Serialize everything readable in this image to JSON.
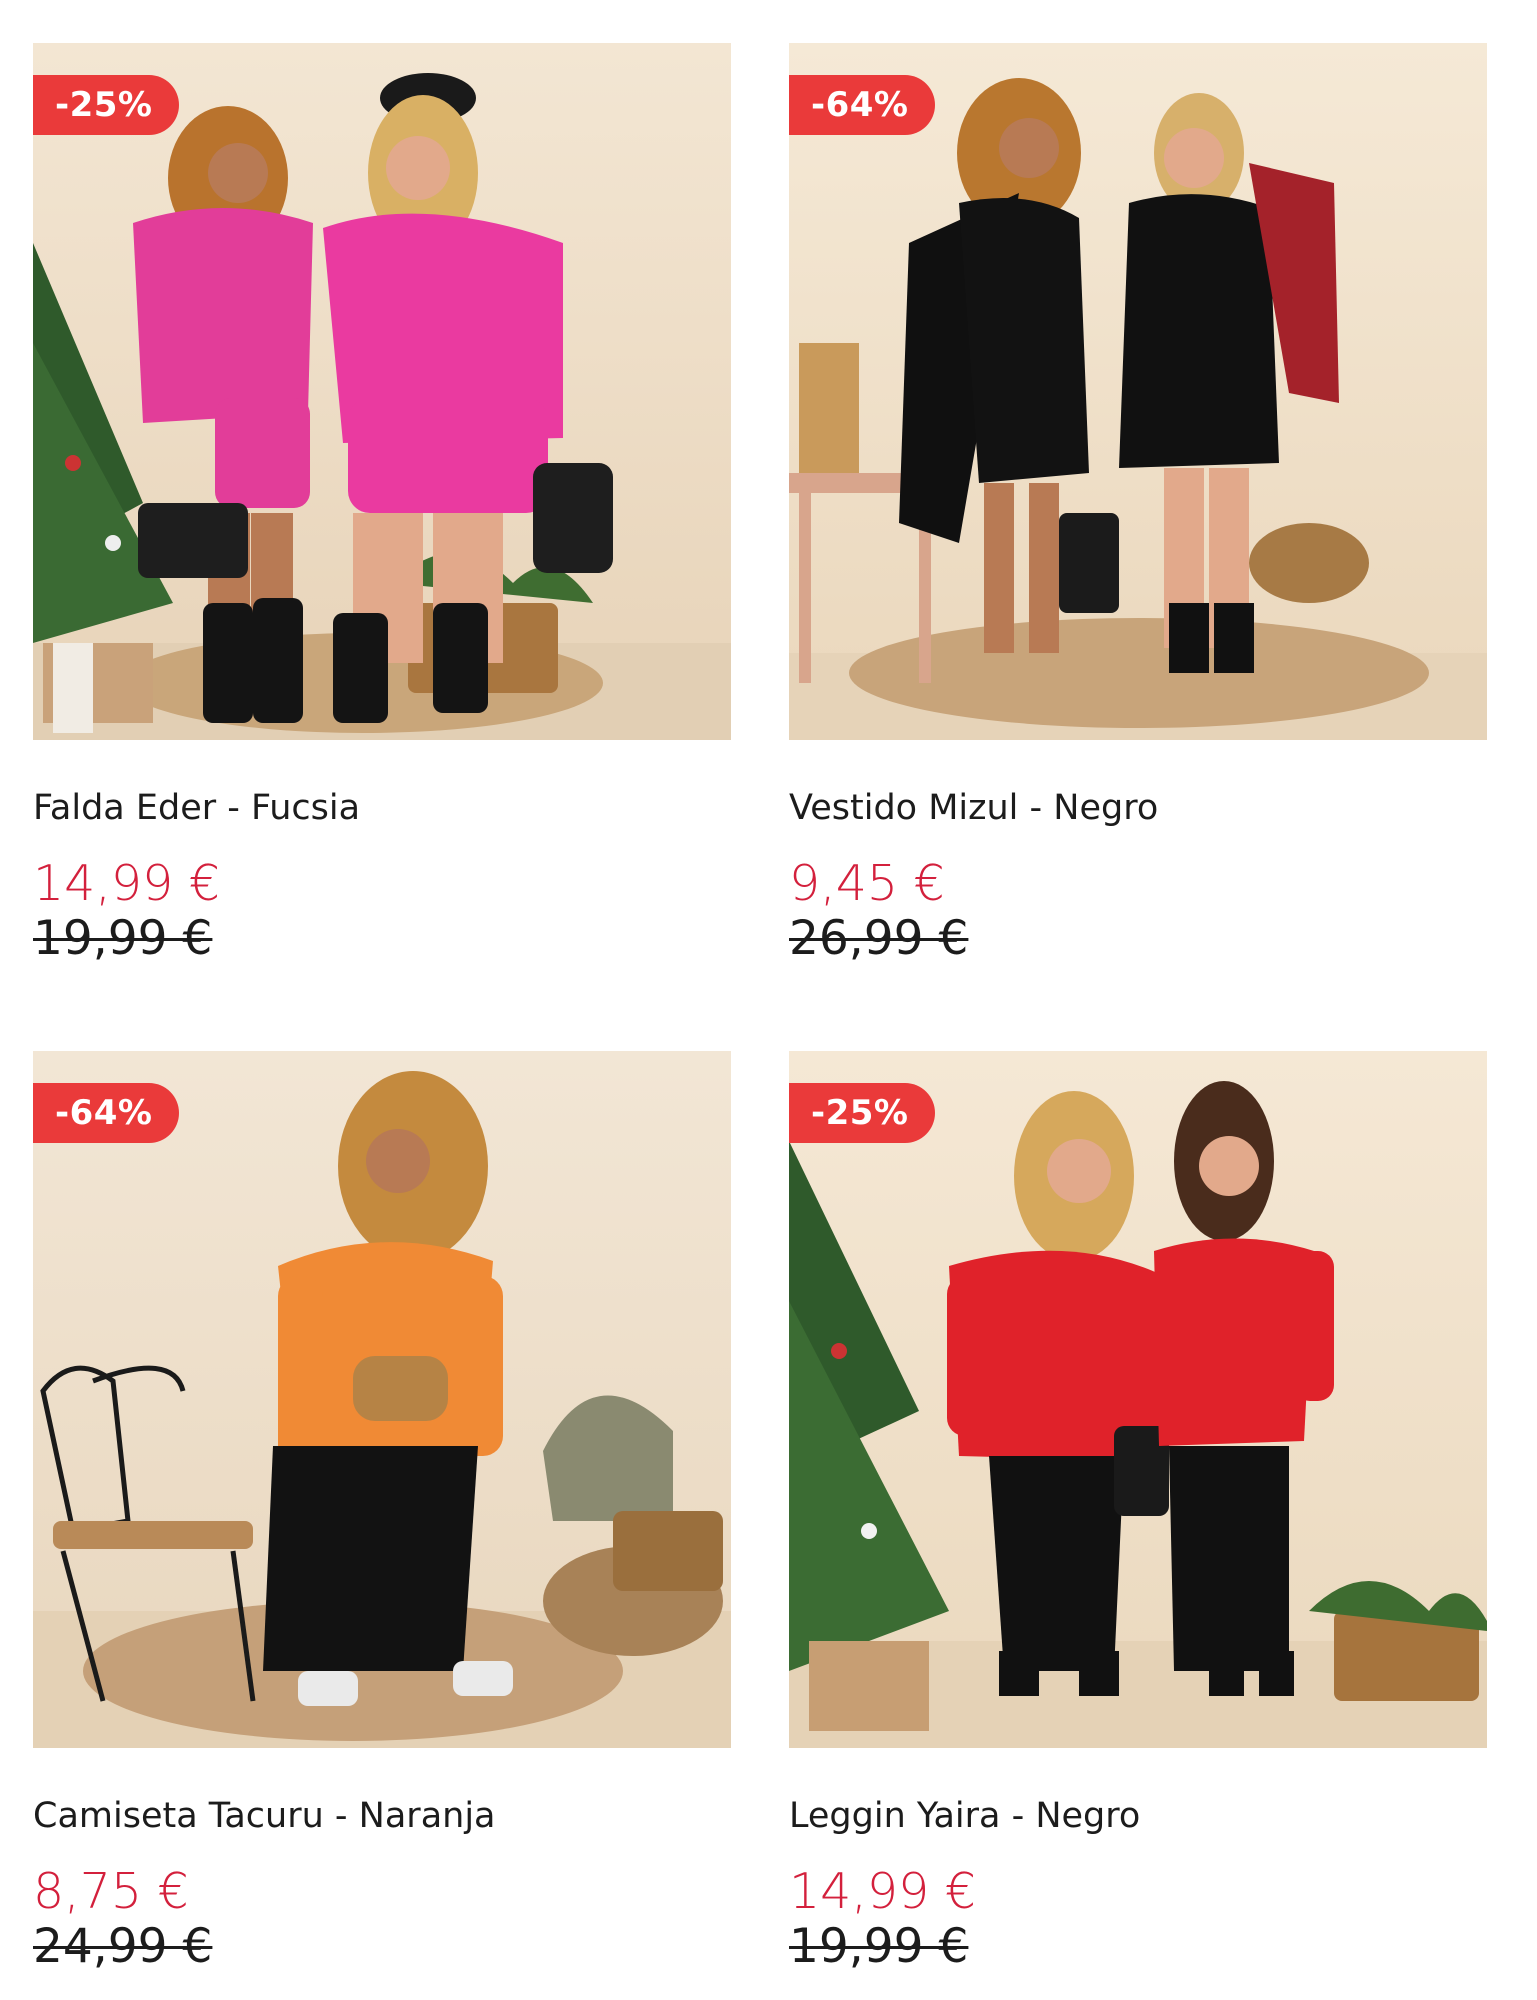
{
  "products": [
    {
      "badge": "-25%",
      "title": "Falda Eder - Fucsia",
      "price": "14,99 €",
      "old_price": "19,99 €",
      "image": "product-photo-fucsia"
    },
    {
      "badge": "-64%",
      "title": "Vestido Mizul - Negro",
      "price": "9,45 €",
      "old_price": "26,99 €",
      "image": "product-photo-negro-dress"
    },
    {
      "badge": "-64%",
      "title": "Camiseta Tacuru - Naranja",
      "price": "8,75 €",
      "old_price": "24,99 €",
      "image": "product-photo-naranja"
    },
    {
      "badge": "-25%",
      "title": "Leggin Yaira - Negro",
      "price": "14,99 €",
      "old_price": "19,99 €",
      "image": "product-photo-leggin-negro"
    }
  ],
  "colors": {
    "badge_bg": "#ea3a3a",
    "sale_price": "#d3203c",
    "text": "#1c1c1c"
  }
}
